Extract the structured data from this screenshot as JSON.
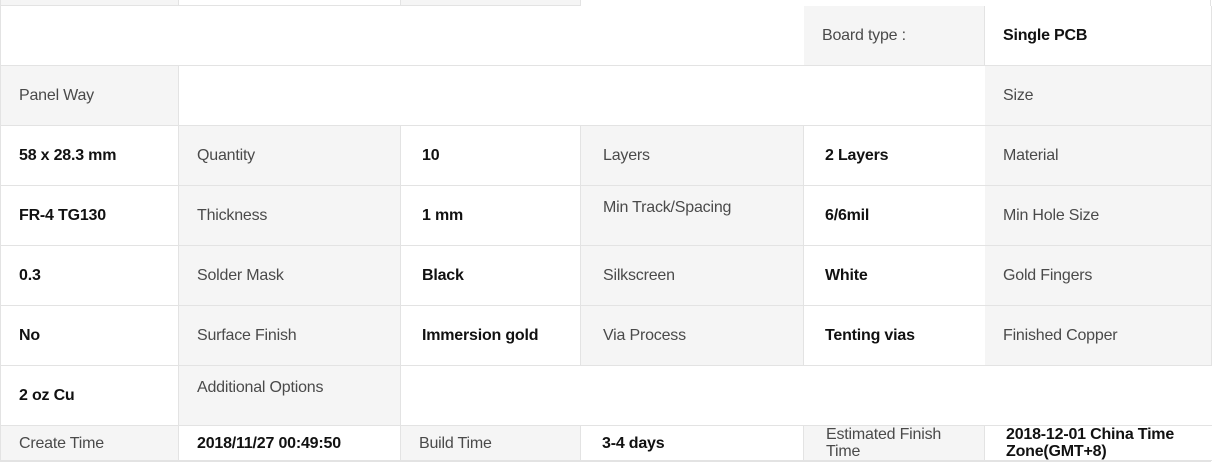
{
  "rows": [
    {
      "label1": "Board type :",
      "value1": "Single PCB",
      "label2": "Panel Way",
      "value2": ""
    },
    {
      "label1": "Size",
      "value1": "58 x 28.3 mm",
      "label2": "Quantity",
      "value2": "10",
      "label3": "Layers",
      "value3": "2 Layers"
    },
    {
      "label1": "Material",
      "value1": "FR-4 TG130",
      "label2": "Thickness",
      "value2": "1 mm",
      "label3": "Min Track/Spacing",
      "value3": "6/6mil"
    },
    {
      "label1": "Min Hole Size",
      "value1": "0.3",
      "label2": "Solder Mask",
      "value2": "Black",
      "label3": "Silkscreen",
      "value3": "White"
    },
    {
      "label1": "Gold Fingers",
      "value1": "No",
      "label2": "Surface Finish",
      "value2": "Immersion gold",
      "label3": "Via Process",
      "value3": "Tenting vias"
    },
    {
      "label1": "Finished Copper",
      "value1": "2 oz Cu",
      "label2": "Additional Options",
      "value2": ""
    },
    {
      "label1": "Create Time",
      "value1": "2018/11/27 00:49:50",
      "label2": "Build Time",
      "value2": "3-4 days",
      "label3": "Estimated Finish Time",
      "value3": "2018-12-01 China Time Zone(GMT+8)"
    }
  ]
}
